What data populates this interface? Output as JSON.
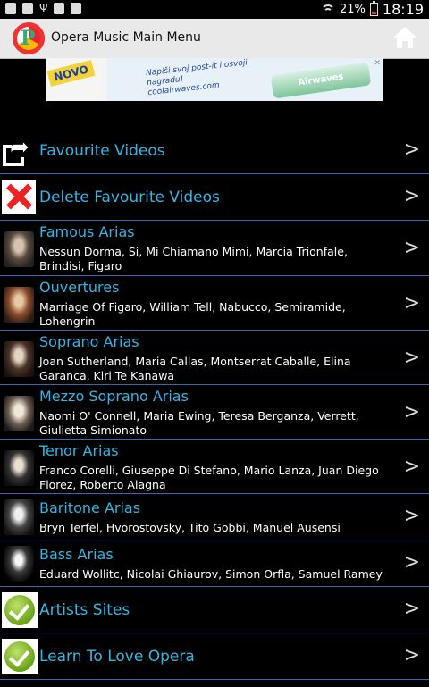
{
  "status_bar": {
    "battery_pct": "21%",
    "time": "18:19",
    "icons": [
      "facebook-icon",
      "android-icon",
      "usb-icon",
      "photo-icon",
      "photo-icon"
    ]
  },
  "action_bar": {
    "title": "Opera Music Main Menu",
    "home_icon": "home-icon"
  },
  "ad": {
    "badge": "NOVO",
    "text": "Napiši svoj post-it i osvoji nagradu! coolairwaves.com",
    "product": "Airwaves"
  },
  "menu": [
    {
      "title": "Favourite Videos",
      "subtitle": "",
      "icon": "share-icon"
    },
    {
      "title": "Delete Favourite Videos",
      "subtitle": "",
      "icon": "delete-icon"
    },
    {
      "title": "Famous Arias",
      "subtitle": "Nessun Dorma, Si, Mi Chiamano Mimi, Marcia Trionfale, Brindisi, Figaro",
      "icon": "portrait-icon"
    },
    {
      "title": "Ouvertures",
      "subtitle": "Marriage Of Figaro, William Tell, Nabucco, Semiramide, Lohengrin",
      "icon": "portrait-icon"
    },
    {
      "title": "Soprano Arias",
      "subtitle": "Joan Sutherland, Maria Callas, Montserrat Caballe, Elina Garanca, Kiri Te Kanawa",
      "icon": "portrait-icon"
    },
    {
      "title": "Mezzo Soprano Arias",
      "subtitle": "Naomi O' Connell, Maria Ewing, Teresa Berganza, Verrett, Giulietta Simionato",
      "icon": "portrait-icon"
    },
    {
      "title": "Tenor Arias",
      "subtitle": "Franco Corelli, Giuseppe Di Stefano, Mario Lanza, Juan Diego Florez, Roberto Alagna",
      "icon": "portrait-icon"
    },
    {
      "title": "Baritone Arias",
      "subtitle": "Bryn Terfel, Hvorostovsky, Tito Gobbi, Manuel Ausensi",
      "icon": "portrait-icon"
    },
    {
      "title": "Bass Arias",
      "subtitle": "Eduard Wollitc, Nicolai Ghiaurov, Simon Orfla, Samuel Ramey",
      "icon": "portrait-icon"
    },
    {
      "title": "Artists Sites",
      "subtitle": "",
      "icon": "checkmark-icon"
    },
    {
      "title": "Learn To Love Opera",
      "subtitle": "",
      "icon": "checkmark-icon"
    }
  ],
  "chevron": ">",
  "colors": {
    "title": "#33b5e5",
    "divider": "#2b6cae",
    "background": "#000000",
    "action_bar": "#e9e9e9"
  }
}
